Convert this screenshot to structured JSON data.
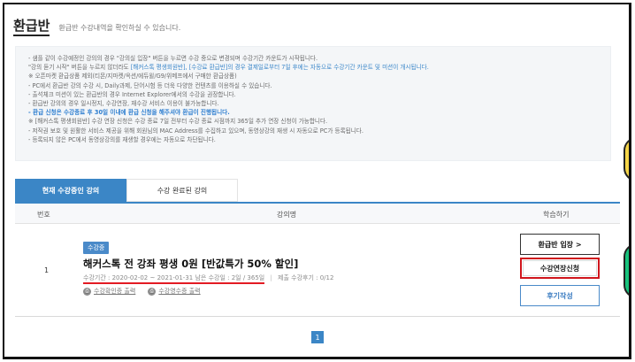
{
  "header": {
    "title": "환급반",
    "subtitle": "환급반 수강내역을 확인하실 수 있습니다."
  },
  "notice": {
    "lines": [
      {
        "text": "- 샘플 같이 수강예정인 강의의 경우 \"강의실 입장\" 버튼을 누르면 수강 중으로 변경되며 수강기간 카운트가 시작됩니다.",
        "style": "normal"
      },
      {
        "text": "\"강의 듣기 시작\" 버튼을 누르지 않더라도 [해커스톡 평생회원반], [수강료 환급반]의 경우 결제일로부터 7일 후에는 자동으로 수강기간 카운트 및 미션이 개시됩니다.",
        "style": "mixed",
        "pre": "  \"강의 듣기 시작\" 버튼을 누르지 않더라도 ",
        "hl": "[해커스톡 평생회원반], [수강료 환급반]의 경우 결제일로부터 7일 후에는 자동으로 수강기간 카운트 및 미션이 개시됩니다.",
        "post": ""
      },
      {
        "text": "  ※ 오픈마켓 환급상품 제외(티몬/지마켓/옥션/에듀윌/G9/위메프에서 구매한 환급상품)",
        "style": "normal"
      },
      {
        "text": "- PC에서 환급반 강의 수강 시, Daily과제, 단어시험 등 더욱 다양한 컨텐츠를 이용하실 수 있습니다.",
        "style": "normal"
      },
      {
        "text": "- 출석체크 미션이 있는 환급반의 경우 Internet Explorer에서의 수강을 권장합니다.",
        "style": "normal"
      },
      {
        "text": "- 환급반 강의의 경우 일시정지, 수강연장, 재수강 서비스 이용이 불가능합니다.",
        "style": "normal"
      },
      {
        "text": "- 환급 신청은 수강종료 후 30일 이내에 환급 신청을 해주셔야 환급이 진행됩니다.",
        "style": "bold-blue"
      },
      {
        "text": "  ※ [해커스톡 평생회원반] 수강 연장 신청은 수강 종료 7일 전부터 수강 종료 시점까지 365일 추가 연장 신청이 가능합니다.",
        "style": "normal"
      },
      {
        "text": "- 저작권 보호 및 원활한 서비스 제공을 위해 회원님의 MAC Address를 수집하고 있으며, 동영상강의 재생 시 자동으로 PC가 등록됩니다.",
        "style": "normal"
      },
      {
        "text": "- 등록되지 않은 PC에서 동영상강의를 재생할 경우에는 자동으로 차단됩니다.",
        "style": "normal"
      }
    ]
  },
  "tabs": [
    {
      "label": "현재 수강중인 강의",
      "active": true
    },
    {
      "label": "수강 완료된 강의",
      "active": false
    }
  ],
  "table": {
    "headers": {
      "no": "번호",
      "course": "강의명",
      "study": "학습하기"
    },
    "rows": [
      {
        "no": "1",
        "badge": "수강중",
        "title": "해커스톡 전 강좌 평생 0원 [반값특가 50% 할인]",
        "period": "수강기간 : 2020-02-02 ~ 2021-01-31 남은 수강일 : 2일 / 365일",
        "review_count": "제출 수강후기 : 0/12",
        "link_print_confirm": "수강확인증 출력",
        "link_print_receipt": "수강영수증 출력",
        "btn_enter": "환급반 입장 >",
        "btn_extend": "수강연장신청",
        "btn_review": "후기작성"
      }
    ]
  },
  "pagination": {
    "current": "1"
  },
  "colors": {
    "accent": "#3b86c6",
    "highlight_red": "#d0161d"
  }
}
